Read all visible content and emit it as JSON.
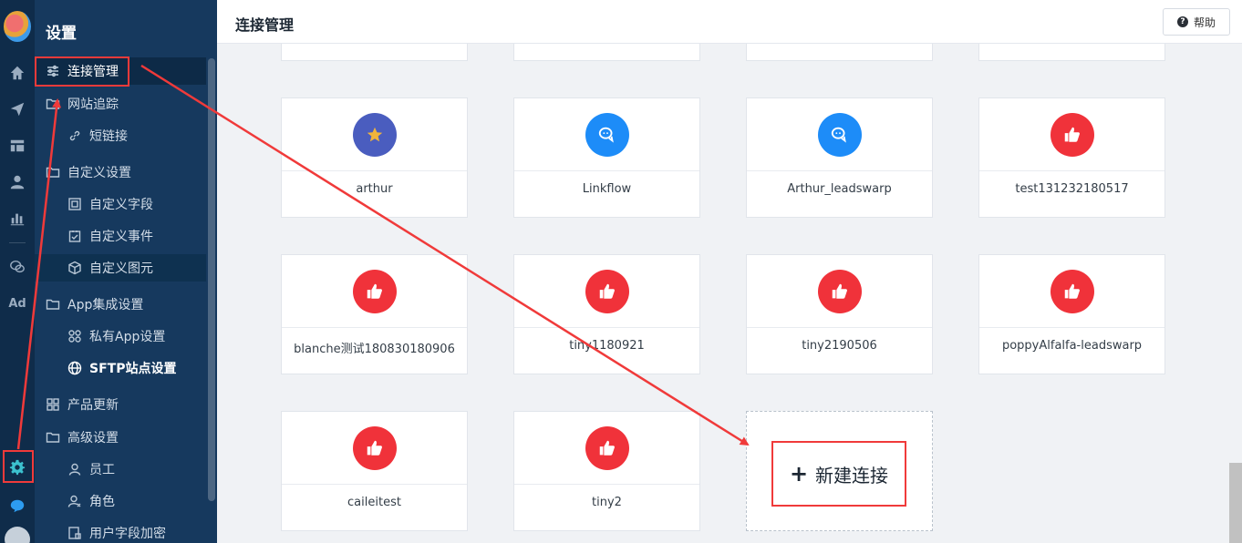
{
  "sidebar": {
    "title": "设置",
    "items": [
      {
        "label": "连接管理",
        "icon": "sliders-icon"
      },
      {
        "label": "网站追踪",
        "icon": "folder-icon"
      },
      {
        "label": "短链接",
        "icon": "link-icon"
      },
      {
        "label": "自定义设置",
        "icon": "folder-icon"
      },
      {
        "label": "自定义字段",
        "icon": "field-icon"
      },
      {
        "label": "自定义事件",
        "icon": "event-icon"
      },
      {
        "label": "自定义图元",
        "icon": "cube-icon"
      },
      {
        "label": "App集成设置",
        "icon": "folder-icon"
      },
      {
        "label": "私有App设置",
        "icon": "apps-icon"
      },
      {
        "label": "SFTP站点设置",
        "icon": "globe-icon"
      },
      {
        "label": "产品更新",
        "icon": "grid-icon"
      },
      {
        "label": "高级设置",
        "icon": "folder-icon"
      },
      {
        "label": "员工",
        "icon": "user-icon"
      },
      {
        "label": "角色",
        "icon": "role-icon"
      },
      {
        "label": "用户字段加密",
        "icon": "lock-field-icon"
      }
    ]
  },
  "rail": {
    "icons": [
      "home-icon",
      "send-icon",
      "layout-icon",
      "user-icon",
      "chart-icon",
      "wechat-icon",
      "ad-icon",
      "gear-icon",
      "chat-icon"
    ],
    "ad_label": "Ad"
  },
  "header": {
    "title": "连接管理",
    "help_label": "帮助"
  },
  "connections": [
    {
      "name": "arthur",
      "icon": "star-icon",
      "color": "#4a5dbf"
    },
    {
      "name": "Linkflow",
      "icon": "wechat-icon",
      "color": "#1d8cf8"
    },
    {
      "name": "Arthur_leadswarp",
      "icon": "wechat-icon",
      "color": "#1d8cf8"
    },
    {
      "name": "test131232180517",
      "icon": "thumbs-up-icon",
      "color": "#f0323a"
    },
    {
      "name": "blanche测试180830180906",
      "icon": "thumbs-up-icon",
      "color": "#f0323a"
    },
    {
      "name": "tiny1180921",
      "icon": "thumbs-up-icon",
      "color": "#f0323a"
    },
    {
      "name": "tiny2190506",
      "icon": "thumbs-up-icon",
      "color": "#f0323a"
    },
    {
      "name": "poppyAlfalfa-leadswarp",
      "icon": "thumbs-up-icon",
      "color": "#f0323a"
    },
    {
      "name": "caileitest",
      "icon": "thumbs-up-icon",
      "color": "#f0323a"
    },
    {
      "name": "tiny2",
      "icon": "thumbs-up-icon",
      "color": "#f0323a"
    }
  ],
  "new_connection": {
    "label": "新建连接"
  },
  "colors": {
    "annotation_red": "#f03a3a",
    "sidebar_bg": "#16395e",
    "rail_bg": "#0f2c4a"
  }
}
